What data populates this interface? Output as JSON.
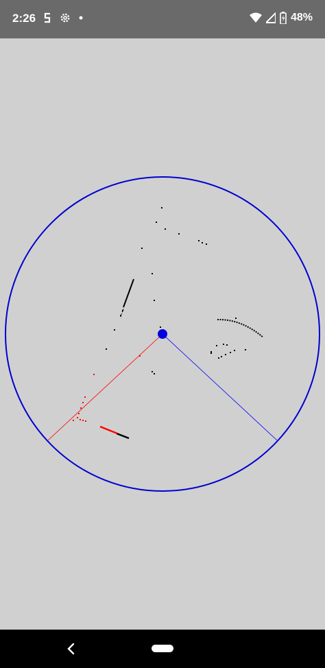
{
  "status_bar": {
    "time": "2:26",
    "battery_text": "48%",
    "left_icons": [
      "s-logo-icon",
      "gear-icon",
      "dot-icon"
    ],
    "right_icons": [
      "wifi-icon",
      "cell-signal-icon",
      "battery-icon"
    ],
    "background_color": "#6a6a6a"
  },
  "canvas": {
    "background_color": "#d0d0d0",
    "range_circle_color": "#0000d0",
    "robot_color": "#0000e0",
    "left_ray_color": "#ff0000",
    "right_ray_color": "#0000ff",
    "point_colors": {
      "obstacle": "#000000",
      "highlighted": "#ff0000"
    }
  },
  "nav_bar": {
    "icons": [
      "back-icon",
      "home-pill"
    ]
  }
}
